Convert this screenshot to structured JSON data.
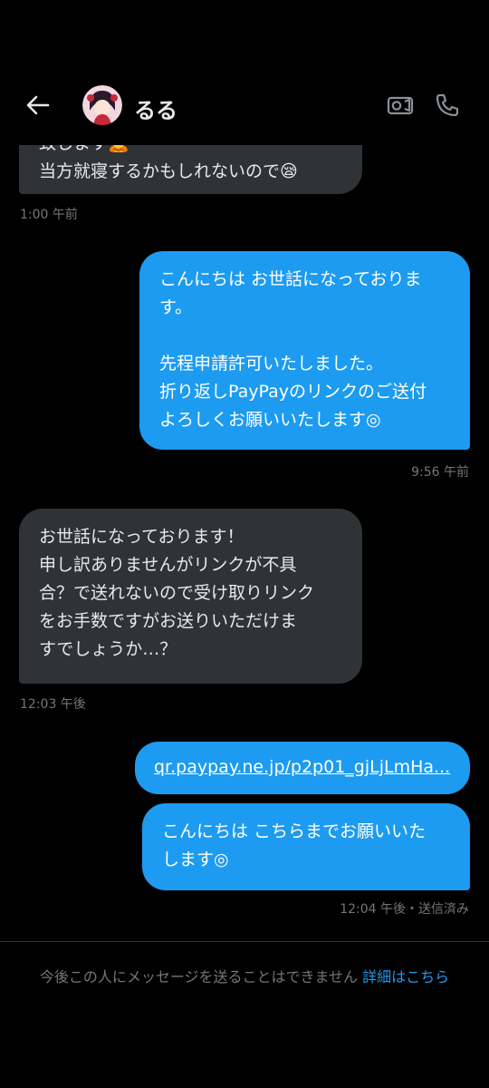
{
  "header": {
    "name": "るる"
  },
  "messages": [
    {
      "id": "m1",
      "direction": "in",
      "lines": [
        "致します🙇",
        "当方就寝するかもしれないので😪"
      ],
      "time": "1:00 午前"
    },
    {
      "id": "m2",
      "direction": "out",
      "lines": [
        "こんにちは お世話になっておりま",
        "す。",
        "",
        "先程申請許可いたしました。",
        "折り返しPayPayのリンクのご送付",
        "よろしくお願いいたします◎"
      ],
      "time": "9:56 午前"
    },
    {
      "id": "m3",
      "direction": "in",
      "lines": [
        "お世話になっております！",
        "申し訳ありませんがリンクが不具",
        "合？で送れないので受け取りリンク",
        "をお手数ですがお送りいただけま",
        "すでしょうか…？"
      ],
      "time": "12:03 午後"
    },
    {
      "id": "m4",
      "direction": "out",
      "link": "qr.paypay.ne.jp/p2p01_gjLjLmHa..."
    },
    {
      "id": "m5",
      "direction": "out",
      "lines": [
        "こんにちは こちらまでお願いいた",
        "します◎"
      ],
      "time": "12:04 午後・送信済み"
    }
  ],
  "footer": {
    "text": "今後この人にメッセージを送ることはできません ",
    "link": "詳細はこちら"
  },
  "colors": {
    "background": "#000000",
    "incoming_bubble": "#2f3336",
    "outgoing_bubble": "#1d9bf0",
    "muted_text": "#71767b",
    "link": "#1d9bf0"
  },
  "icons": [
    "back-arrow-icon",
    "video-call-icon",
    "phone-icon"
  ]
}
